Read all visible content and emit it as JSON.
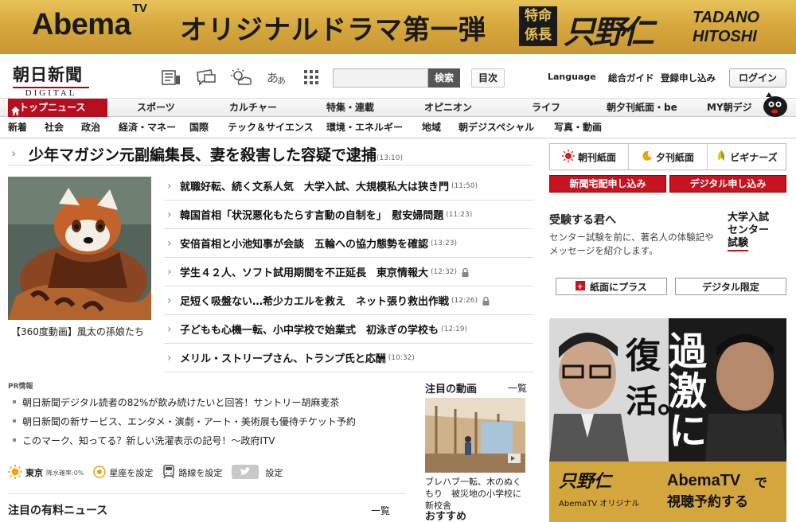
{
  "banner": {
    "brand": "Abema",
    "brand_sup": "TV",
    "headline": "オリジナルドラマ第一弾",
    "show_badge": "特命係長",
    "show_title": "只野仁",
    "show_roman_1": "TADANO",
    "show_roman_2": "HITOSHI"
  },
  "logo": {
    "ja": "朝日新聞",
    "en": "DIGITAL"
  },
  "header": {
    "search_button": "検索",
    "toc_button": "目次",
    "language": "Language",
    "guide": "総合ガイド",
    "subscribe": "登録申し込み",
    "login": "ログイン"
  },
  "nav_primary": [
    "トップニュース",
    "スポーツ",
    "カルチャー",
    "特集・連載",
    "オピニオン",
    "ライフ",
    "朝夕刊紙面・be",
    "MY朝デジ"
  ],
  "nav_secondary": [
    "新着",
    "社会",
    "政治",
    "経済・マネー",
    "国際",
    "テック＆サイエンス",
    "環境・エネルギー",
    "地域",
    "朝デジスペシャル",
    "写真・動画"
  ],
  "top_story": {
    "title": "少年マガジン元副編集長、妻を殺害した容疑で逮捕",
    "time": "(13:10)"
  },
  "photo_caption": "【360度動画】風太の孫娘たち",
  "news": [
    {
      "title": "就職好転、続く文系人気　大学入試、大規模私大は狭き門",
      "time": "(11:50)",
      "locked": false
    },
    {
      "title": "韓国首相「状況悪化もたらす言動の自制を」　慰安婦問題",
      "time": "(11:23)",
      "locked": false
    },
    {
      "title": "安倍首相と小池知事が会談　五輪への協力態勢を確認",
      "time": "(13:23)",
      "locked": false
    },
    {
      "title": "学生４２人、ソフト試用期間を不正延長　東京情報大",
      "time": "(12:32)",
      "locked": true
    },
    {
      "title": "足短く吸盤ない…希少カエルを救え　ネット張り救出作戦",
      "time": "(12:26)",
      "locked": true
    },
    {
      "title": "子どもも心機一転、小中学校で始業式　初泳ぎの学校も",
      "time": "(12:19)",
      "locked": false
    },
    {
      "title": "メリル・ストリープさん、トランプ氏と応酬",
      "time": "(10:32)",
      "locked": false
    }
  ],
  "pr": {
    "label": "PR情報",
    "items": [
      "朝日新聞デジタル読者の82%が飲み続けたいと回答！サントリー胡麻麦茶",
      "朝日新聞の新サービス、エンタメ・演劇・アート・美術展も優待チケット予約",
      "このマーク、知ってる？新しい洗濯表示の記号！～政府ITV"
    ]
  },
  "utility": {
    "city": "東京",
    "weather_note": "降水確率:0%",
    "horoscope": "星座を設定",
    "route": "路線を設定",
    "settings": "設定"
  },
  "paid_news": {
    "title": "注目の有料ニュース",
    "more": "一覧"
  },
  "video": {
    "title": "注目の動画",
    "more": "一覧",
    "caption": "ブレハブ一転、木のぬくもり　被災地の小学校に新校舎",
    "recommend": "おすすめ"
  },
  "right": {
    "tabs": [
      "朝刊紙面",
      "夕刊紙面",
      "ビギナーズ"
    ],
    "buttons": [
      "新聞宅配申し込み",
      "デジタル申し込み"
    ],
    "exam_title": "受験する君へ",
    "exam_desc": "センター試験を前に、著名人の体験記やメッセージを紹介します。",
    "exam_badge_1": "大学入試",
    "exam_badge_2": "センター",
    "exam_badge_3": "試験",
    "links": [
      "紙面にプラス",
      "デジタル限定"
    ]
  },
  "ad": {
    "headline_1": "過",
    "headline_2": "激",
    "headline_3": "に",
    "headline_4": "復",
    "headline_5": "活。",
    "brand": "AbemaTV",
    "cta_1": "で",
    "cta_2": "視聴予約する",
    "show": "只野仁",
    "sub": "AbemaTV オリジナル"
  },
  "colors": {
    "brand_red": "#b80d1e",
    "gold": "#d7a93e"
  }
}
